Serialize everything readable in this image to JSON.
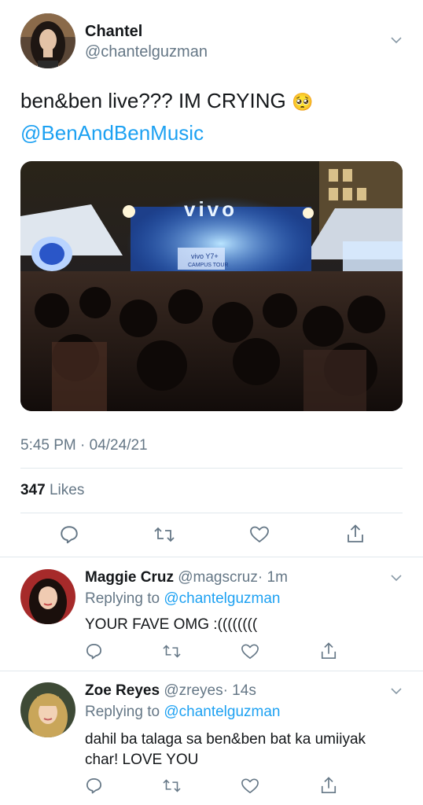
{
  "tweet": {
    "display_name": "Chantel",
    "handle": "@chantelguzman",
    "text_main": "ben&ben live??? IM CRYING",
    "emoji": "🥺",
    "mention": "@BenAndBenMusic",
    "photo_text": {
      "brand": "vivo",
      "banner_line1": "vivo Y7+",
      "banner_line2": "CAMPUS TOUR"
    },
    "timestamp": "5:45 PM · 04/24/21",
    "likes_count": "347",
    "likes_label": "Likes"
  },
  "replies": [
    {
      "display_name": "Maggie Cruz",
      "handle": "@magscruz",
      "time": "· 1m",
      "replying_label": "Replying to",
      "replying_to": "@chantelguzman",
      "text": "YOUR FAVE OMG :(((((((("
    },
    {
      "display_name": "Zoe Reyes",
      "handle": "@zreyes",
      "time": "· 14s",
      "replying_label": "Replying to",
      "replying_to": "@chantelguzman",
      "text_line1": "dahil ba talaga sa ben&ben bat ka umiiyak",
      "text_line2": "char! LOVE YOU"
    }
  ],
  "icons": {
    "reply": "reply-icon",
    "retweet": "retweet-icon",
    "like": "heart-icon",
    "share": "share-icon",
    "more": "chevron-down-icon"
  },
  "colors": {
    "link": "#1da1f2",
    "muted": "#657786",
    "text": "#14171a",
    "divider": "#e1e8ed"
  }
}
